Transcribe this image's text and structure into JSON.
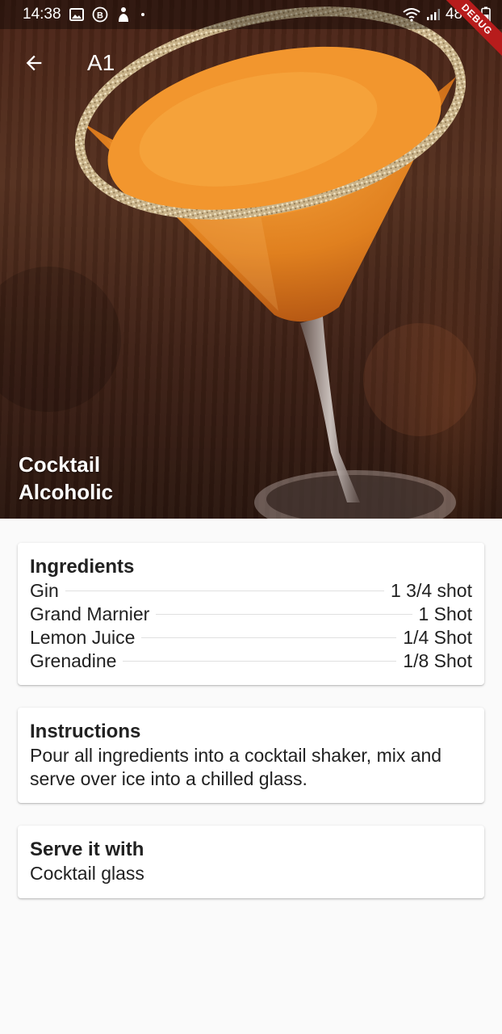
{
  "status_bar": {
    "time": "14:38",
    "battery": "48%",
    "icons": [
      "image-icon",
      "b-circle-icon",
      "gesture-icon",
      "dot-icon",
      "wifi-icon",
      "signal-icon",
      "battery-icon"
    ]
  },
  "debug_banner": "DEBUG",
  "app_bar": {
    "title": "A1",
    "back_icon": "arrow-back-icon"
  },
  "hero": {
    "category": "Cocktail",
    "alcoholic": "Alcoholic"
  },
  "ingredients": {
    "title": "Ingredients",
    "items": [
      {
        "name": "Gin",
        "measure": "1 3/4 shot"
      },
      {
        "name": "Grand Marnier",
        "measure": "1 Shot"
      },
      {
        "name": "Lemon Juice",
        "measure": "1/4 Shot"
      },
      {
        "name": "Grenadine",
        "measure": "1/8 Shot"
      }
    ]
  },
  "instructions": {
    "title": "Instructions",
    "text": "Pour all ingredients into a cocktail shaker, mix and serve over ice into a chilled glass."
  },
  "serve": {
    "title": "Serve it with",
    "glass": "Cocktail glass"
  },
  "colors": {
    "drink": "#e8872a",
    "background": "#fafafa",
    "text": "#212121",
    "debug": "#b71c1c"
  }
}
